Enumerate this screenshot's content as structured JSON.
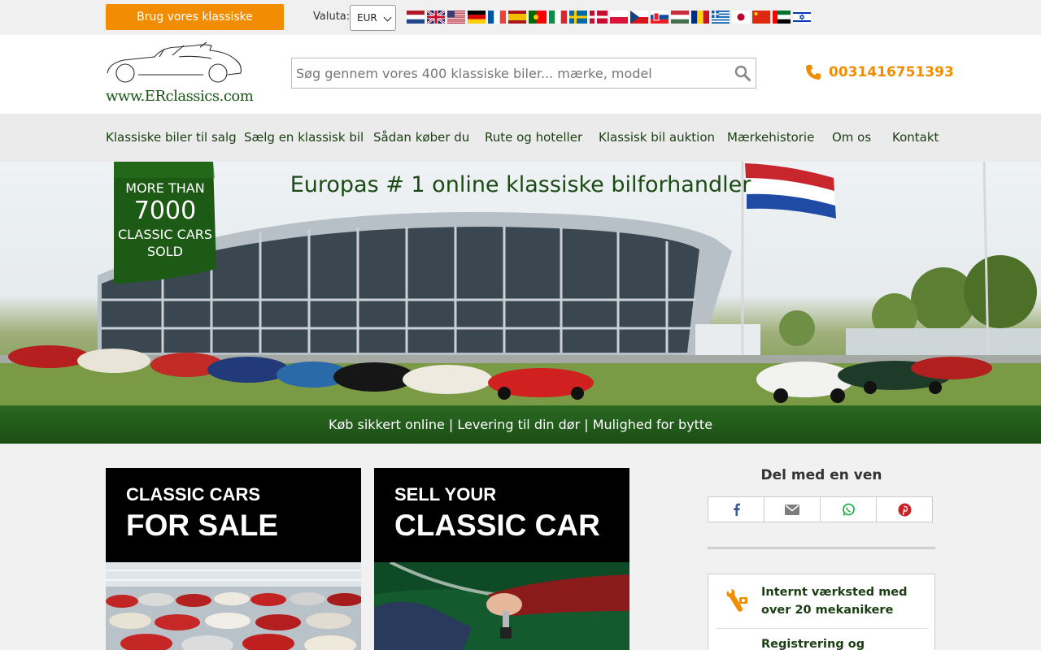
{
  "topbar": {
    "advisor_button": "Brug vores klassiske bilrådgiver",
    "currency_label": "Valuta:",
    "currency_value": "EUR",
    "flags": [
      "nl-flag-icon",
      "uk-flag-icon",
      "us-flag-icon",
      "de-flag-icon",
      "fr-flag-icon",
      "es-flag-icon",
      "pt-flag-icon",
      "it-flag-icon",
      "se-flag-icon",
      "dk-flag-icon",
      "pl-flag-icon",
      "cz-flag-icon",
      "sk-flag-icon",
      "hu-flag-icon",
      "ro-flag-icon",
      "gr-flag-icon",
      "jp-flag-icon",
      "cn-flag-icon",
      "ae-flag-icon",
      "il-flag-icon"
    ]
  },
  "header": {
    "logo_text": "www.ERclassics.com",
    "search_placeholder": "Søg gennem vores 400 klassiske biler... mærke, model",
    "phone": "0031416751393"
  },
  "nav": {
    "items": [
      "Klassiske biler til salg",
      "Sælg en klassisk bil",
      "Sådan køber du",
      "Rute og hoteller",
      "Klassisk bil auktion",
      "Mærkehistorie",
      "Om os",
      "Kontakt"
    ]
  },
  "hero": {
    "title": "Europas # 1 online klassiske bilforhandler",
    "badge_line1": "MORE THAN",
    "badge_number": "7000",
    "badge_line2": "CLASSIC CARS",
    "badge_line3": "SOLD",
    "bar_text": "Køb sikkert online | Levering til din dør | Mulighed for bytte"
  },
  "tiles": [
    {
      "line1": "CLASSIC CARS",
      "line2": "FOR SALE"
    },
    {
      "line1": "SELL YOUR",
      "line2": "CLASSIC CAR"
    }
  ],
  "share": {
    "title": "Del med en ven",
    "buttons": [
      "facebook-icon",
      "email-icon",
      "whatsapp-icon",
      "pinterest-icon"
    ]
  },
  "features": {
    "item1": "Internt værksted med over 20 mekanikere",
    "item2": "Registrering og"
  },
  "colors": {
    "accent_orange": "#f28c00",
    "brand_green": "#1b4d14",
    "nav_text": "#1a3d12"
  }
}
